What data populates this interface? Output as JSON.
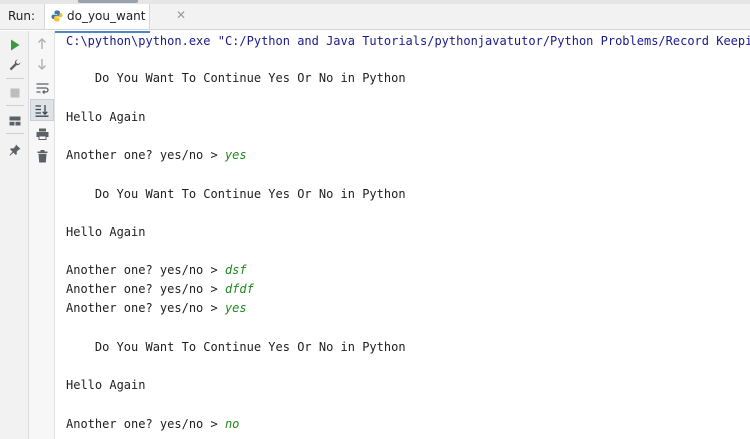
{
  "run": {
    "label": "Run:"
  },
  "tab": {
    "label": "do_you_want",
    "close": "✕"
  },
  "console": {
    "command": "C:\\python\\python.exe \"C:/Python and Java Tutorials/pythonjavatutor/Python Problems/Record Keeping",
    "lines": [
      {
        "text": "    Do You Want To Continue Yes Or No in Python",
        "input": ""
      },
      {
        "text": "Hello Again",
        "input": ""
      },
      {
        "text": "Another one? yes/no > ",
        "input": "yes"
      },
      {
        "text": "    Do You Want To Continue Yes Or No in Python",
        "input": ""
      },
      {
        "text": "Hello Again",
        "input": ""
      },
      {
        "text": "Another one? yes/no > ",
        "input": "dsf"
      },
      {
        "text": "Another one? yes/no > ",
        "input": "dfdf"
      },
      {
        "text": "Another one? yes/no > ",
        "input": "yes"
      },
      {
        "text": "    Do You Want To Continue Yes Or No in Python",
        "input": ""
      },
      {
        "text": "Hello Again",
        "input": ""
      },
      {
        "text": "Another one? yes/no > ",
        "input": "no"
      }
    ]
  },
  "colors": {
    "command": "#1a1a8c",
    "user_input": "#1f8a1f",
    "run_icon": "#3c9a3c",
    "tab_accent": "#4a88c7"
  },
  "icons": {
    "gutter1": [
      "run-icon",
      "wrench-icon",
      "stop-icon",
      "layout-icon",
      "pin-icon"
    ],
    "gutter2": [
      "arrow-up-icon",
      "arrow-down-icon",
      "soft-wrap-icon",
      "scroll-to-end-icon",
      "print-icon",
      "trash-icon"
    ]
  }
}
